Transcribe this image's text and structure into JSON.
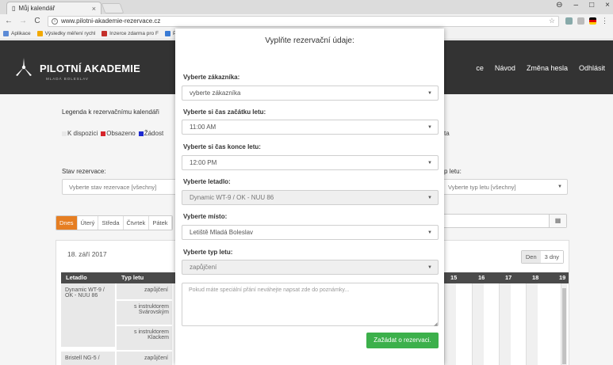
{
  "browser": {
    "tab_title": "Můj kalendář",
    "tab_close": "×",
    "url": "www.pilotni-akademie-rezervace.cz",
    "nav": {
      "back": "←",
      "forward": "→",
      "reload": "C"
    },
    "window_controls": {
      "account": "⊖",
      "minimize": "–",
      "maximize": "□",
      "close": "×"
    },
    "bookmarks": [
      {
        "label": "Aplikace",
        "color": "#5b8ad6"
      },
      {
        "label": "Výsledky měření rychl",
        "color": "#f2a900"
      },
      {
        "label": "Inzerce zdarma pro F",
        "color": "#c4302b"
      },
      {
        "label": "Přerov - Přerovské n",
        "color": "#3a7bd5"
      },
      {
        "label": "PraceRegionu.cz - n",
        "color": "#d9534f"
      },
      {
        "label": "ARES - ekonomické s",
        "color": "#2c6fb7"
      },
      {
        "label": "Formulář pro lustrac",
        "color": "#aaaaaa"
      }
    ]
  },
  "site": {
    "logo_text": "PILOTNÍ AKADEMIE",
    "logo_sub": "MLADÁ BOLESLAV",
    "nav": [
      "ce",
      "Návod",
      "Změna hesla",
      "Odhlásit"
    ]
  },
  "background": {
    "legend_title": "Legenda k rezervačnímu kalendáři",
    "legend": [
      {
        "label": "K dispozici",
        "color": "#e8e8e8"
      },
      {
        "label": "Obsazeno",
        "color": "#d6262c"
      },
      {
        "label": "Žádost",
        "color": "#1e2bd0"
      }
    ],
    "legend_tail": "ta",
    "status_label": "Stav rezervace:",
    "status_value": "Vyberte stav rezervace [všechny]",
    "type_label": "p letu:",
    "type_value": "Vyberte typ letu [všechny]",
    "day_tabs": [
      "Dnes",
      "Úterý",
      "Středa",
      "Čtvrtek",
      "Pátek"
    ],
    "calendar_icon": "▦",
    "panel_date": "18. září 2017",
    "view_buttons": [
      "Den",
      "3 dny"
    ],
    "grid_headers": {
      "aircraft": "Letadlo",
      "flight_type": "Typ letu",
      "hours": [
        "15",
        "16",
        "17",
        "18",
        "19"
      ]
    },
    "rows": [
      {
        "aircraft": "Dynamic WT-9 / OK - NUU 86",
        "types": [
          "zapůjčení",
          "s instruktorem Svárovským",
          "s instruktorem Klackem"
        ]
      },
      {
        "aircraft": "Bristell NG-5 /",
        "types": [
          "zapůjčení"
        ]
      }
    ]
  },
  "modal": {
    "title": "Vyplňte rezervační údaje:",
    "fields": [
      {
        "label": "Vyberte zákazníka:",
        "value": "vyberte zákazníka",
        "disabled": false
      },
      {
        "label": "Vyberte si čas začátku letu:",
        "value": "11:00 AM",
        "disabled": false
      },
      {
        "label": "Vyberte si čas konce letu:",
        "value": "12:00 PM",
        "disabled": false
      },
      {
        "label": "Vyberte letadlo:",
        "value": "Dynamic WT-9 / OK - NUU 86",
        "disabled": true
      },
      {
        "label": "Vyberte místo:",
        "value": "Letiště Mladá Boleslav",
        "disabled": false
      },
      {
        "label": "Vyberte typ letu:",
        "value": "zapůjčení",
        "disabled": true
      }
    ],
    "note_placeholder": "Pokud máte speciální přání neváhejte napsat zde do poznámky...",
    "submit_label": "Zažádat o rezervaci."
  }
}
